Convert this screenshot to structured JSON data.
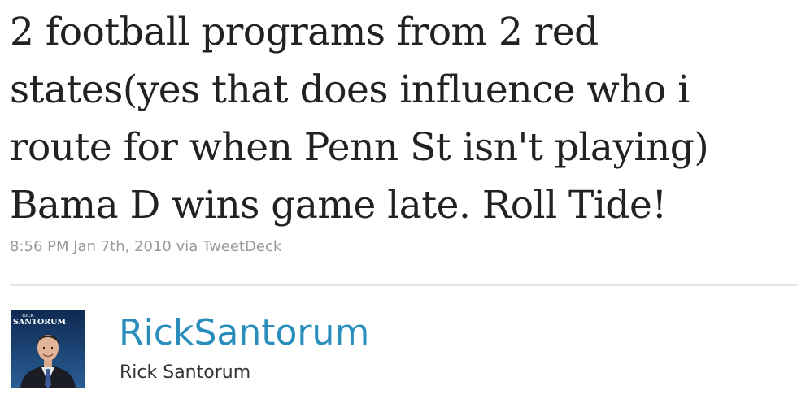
{
  "tweet": {
    "text": "2 football programs from 2 red states(yes that does influence who i route for when Penn St isn't playing) Bama D wins game late. Roll Tide!",
    "timestamp": "8:56 PM Jan 7th, 2010",
    "via_prefix": "via",
    "source": "TweetDeck"
  },
  "author": {
    "screen_name": "RickSantorum",
    "full_name": "Rick Santorum",
    "avatar_caption_small": "RICK",
    "avatar_caption_large": "SANTORUM"
  },
  "colors": {
    "link": "#2a8ebd",
    "text": "#222222",
    "meta": "#999999"
  }
}
